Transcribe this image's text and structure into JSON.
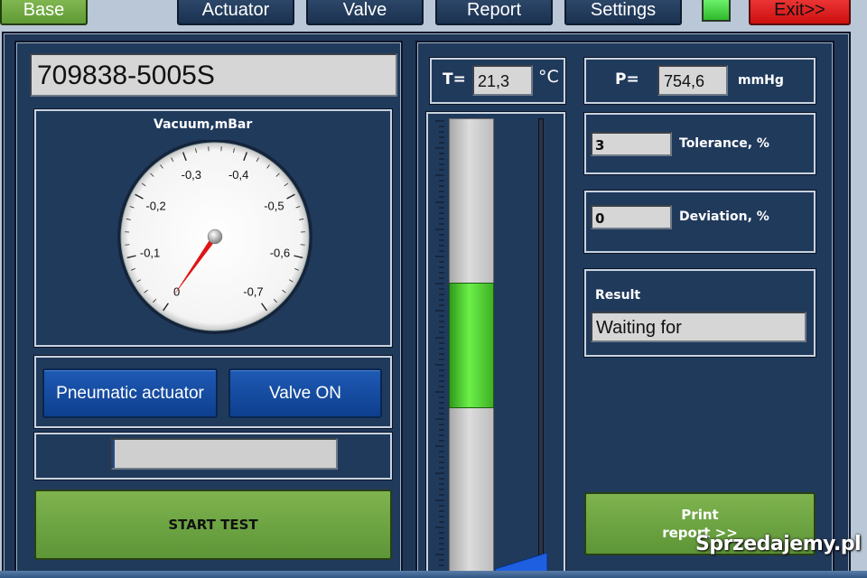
{
  "nav": {
    "base": "Base",
    "actuator": "Actuator",
    "valve": "Valve",
    "report": "Report",
    "settings": "Settings",
    "exit": "Exit>>",
    "indicator_color": "#3fd43a"
  },
  "part_number": "709838-5005S",
  "gauge": {
    "title": "Vacuum,mBar",
    "ticks": [
      "0",
      "-0,1",
      "-0,2",
      "-0,3",
      "-0,4",
      "-0,5",
      "-0,6",
      "-0,7"
    ],
    "value": 0
  },
  "buttons": {
    "pneumatic": "Pneumatic actuator",
    "valve_on": "Valve ON",
    "start_test": "START TEST",
    "print_line1": "Print",
    "print_line2": "report >>"
  },
  "progress": 0,
  "temperature": {
    "label": "T=",
    "value": "21,3",
    "unit": "°C"
  },
  "pressure": {
    "label": "P=",
    "value": "754,6",
    "unit": "mmHg"
  },
  "tolerance": {
    "value": "3",
    "label": "Tolerance, %"
  },
  "deviation": {
    "value": "0",
    "label": "Deviation, %"
  },
  "result": {
    "label": "Result",
    "value": "Waiting for"
  },
  "watermark": "Sprzedajemy.pl",
  "colors": {
    "panel": "#203a5c",
    "exit": "#e21414",
    "green_button": "#6ea342",
    "blue_button": "#1a4fa3",
    "level_green": "#4fcf2e"
  }
}
